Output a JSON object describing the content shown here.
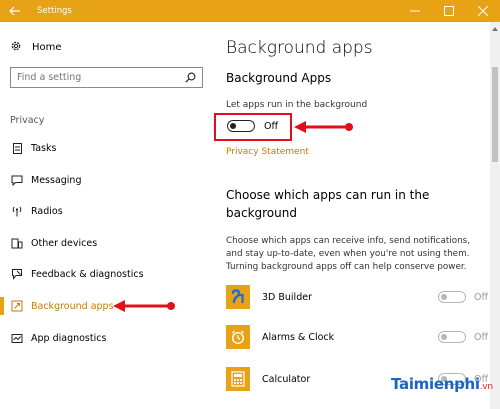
{
  "window": {
    "title": "Settings",
    "accent": "#e8a215"
  },
  "sidebar": {
    "home_label": "Home",
    "search_placeholder": "Find a setting",
    "section_label": "Privacy",
    "items": [
      {
        "label": "Tasks",
        "icon": "tasks-icon"
      },
      {
        "label": "Messaging",
        "icon": "messaging-icon"
      },
      {
        "label": "Radios",
        "icon": "radios-icon"
      },
      {
        "label": "Other devices",
        "icon": "other-devices-icon"
      },
      {
        "label": "Feedback & diagnostics",
        "icon": "feedback-icon"
      },
      {
        "label": "Background apps",
        "icon": "background-apps-icon",
        "active": true
      },
      {
        "label": "App diagnostics",
        "icon": "app-diagnostics-icon"
      }
    ]
  },
  "main": {
    "page_title": "Background apps",
    "section_title": "Background Apps",
    "toggle_label": "Let apps run in the background",
    "toggle_state": "Off",
    "privacy_link": "Privacy Statement",
    "choose_title": "Choose which apps can run in the background",
    "description": "Choose which apps can receive info, send notifications, and stay up-to-date, even when you're not using them. Turning background apps off can help conserve power.",
    "apps": [
      {
        "name": "3D Builder",
        "state": "Off",
        "icon": "3d-builder-icon"
      },
      {
        "name": "Alarms & Clock",
        "state": "Off",
        "icon": "alarms-clock-icon"
      },
      {
        "name": "Calculator",
        "state": "Off",
        "icon": "calculator-icon"
      }
    ]
  },
  "watermark": {
    "text": "Taimienphi",
    "suffix": ".vn"
  }
}
